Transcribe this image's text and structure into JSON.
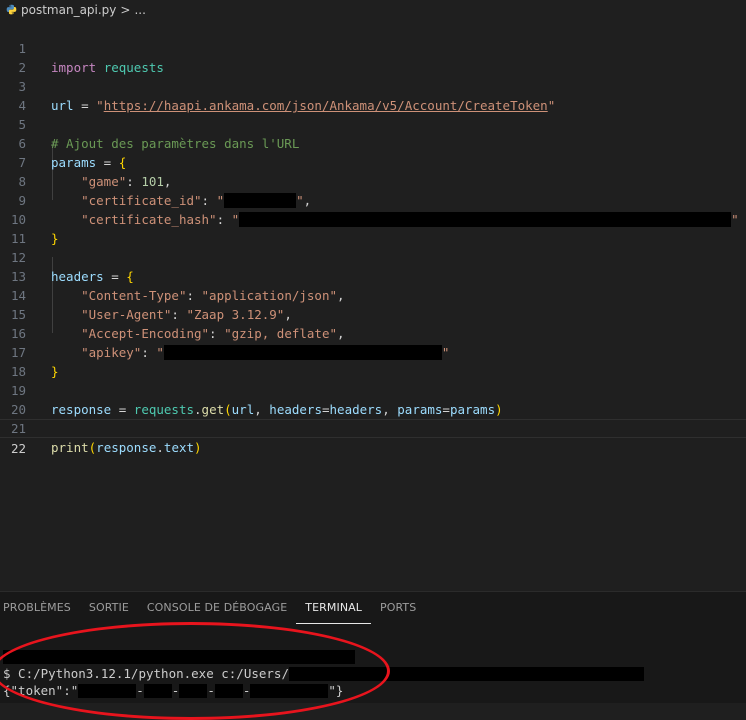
{
  "breadcrumb": {
    "file": "postman_api.py",
    "separator": ">",
    "rest": "..."
  },
  "code": {
    "l1": {
      "num": "1",
      "kw": "import",
      "mod": "requests"
    },
    "l2": {
      "num": "2"
    },
    "l3": {
      "num": "3",
      "var": "url",
      "op": " = ",
      "q1": "\"",
      "url": "https://haapi.ankama.com/json/Ankama/v5/Account/CreateToken",
      "q2": "\""
    },
    "l4": {
      "num": "4"
    },
    "l5": {
      "num": "5",
      "comment": "# Ajout des paramètres dans l'URL"
    },
    "l6": {
      "num": "6",
      "var": "params",
      "op": " = ",
      "brace": "{"
    },
    "l7": {
      "num": "7",
      "key": "\"game\"",
      "colon": ": ",
      "val": "101",
      "comma": ","
    },
    "l8": {
      "num": "8",
      "key": "\"certificate_id\"",
      "colon": ": ",
      "q1": "\"",
      "q2": "\"",
      "comma": ","
    },
    "l9": {
      "num": "9",
      "key": "\"certificate_hash\"",
      "colon": ": ",
      "q1": "\"",
      "q2": "\""
    },
    "l10": {
      "num": "10",
      "brace": "}"
    },
    "l11": {
      "num": "11"
    },
    "l12": {
      "num": "12",
      "var": "headers",
      "op": " = ",
      "brace": "{"
    },
    "l13": {
      "num": "13",
      "key": "\"Content-Type\"",
      "colon": ": ",
      "val": "\"application/json\"",
      "comma": ","
    },
    "l14": {
      "num": "14",
      "key": "\"User-Agent\"",
      "colon": ": ",
      "val": "\"Zaap 3.12.9\"",
      "comma": ","
    },
    "l15": {
      "num": "15",
      "key": "\"Accept-Encoding\"",
      "colon": ": ",
      "val": "\"gzip, deflate\"",
      "comma": ","
    },
    "l16": {
      "num": "16",
      "key": "\"apikey\"",
      "colon": ": ",
      "q1": "\"",
      "q2": "\""
    },
    "l17": {
      "num": "17",
      "brace": "}"
    },
    "l18": {
      "num": "18"
    },
    "l19": {
      "num": "19",
      "var": "response",
      "op": " = ",
      "mod": "requests",
      "dot": ".",
      "fn": "get",
      "p1": "(",
      "a1": "url",
      "c1": ", ",
      "a2": "headers",
      "eq1": "=",
      "a3": "headers",
      "c2": ", ",
      "a4": "params",
      "eq2": "=",
      "a5": "params",
      "p2": ")"
    },
    "l20": {
      "num": "20"
    },
    "l21": {
      "num": "21",
      "fn": "print",
      "p1": "(",
      "a1": "response",
      "dot": ".",
      "a2": "text",
      "p2": ")"
    },
    "l22": {
      "num": "22"
    }
  },
  "panel": {
    "tabs": [
      "PROBLÈMES",
      "SORTIE",
      "CONSOLE DE DÉBOGAGE",
      "TERMINAL",
      "PORTS"
    ],
    "active_tab": "TERMINAL"
  },
  "terminal": {
    "cmd": "$ C:/Python3.12.1/python.exe c:/Users/",
    "out_start": "{\"token\":\"",
    "sep": "-",
    "out_end": "\"}"
  },
  "colors": {
    "annotation_circle": "#e8141d",
    "editor_bg": "#1f1f1f"
  }
}
